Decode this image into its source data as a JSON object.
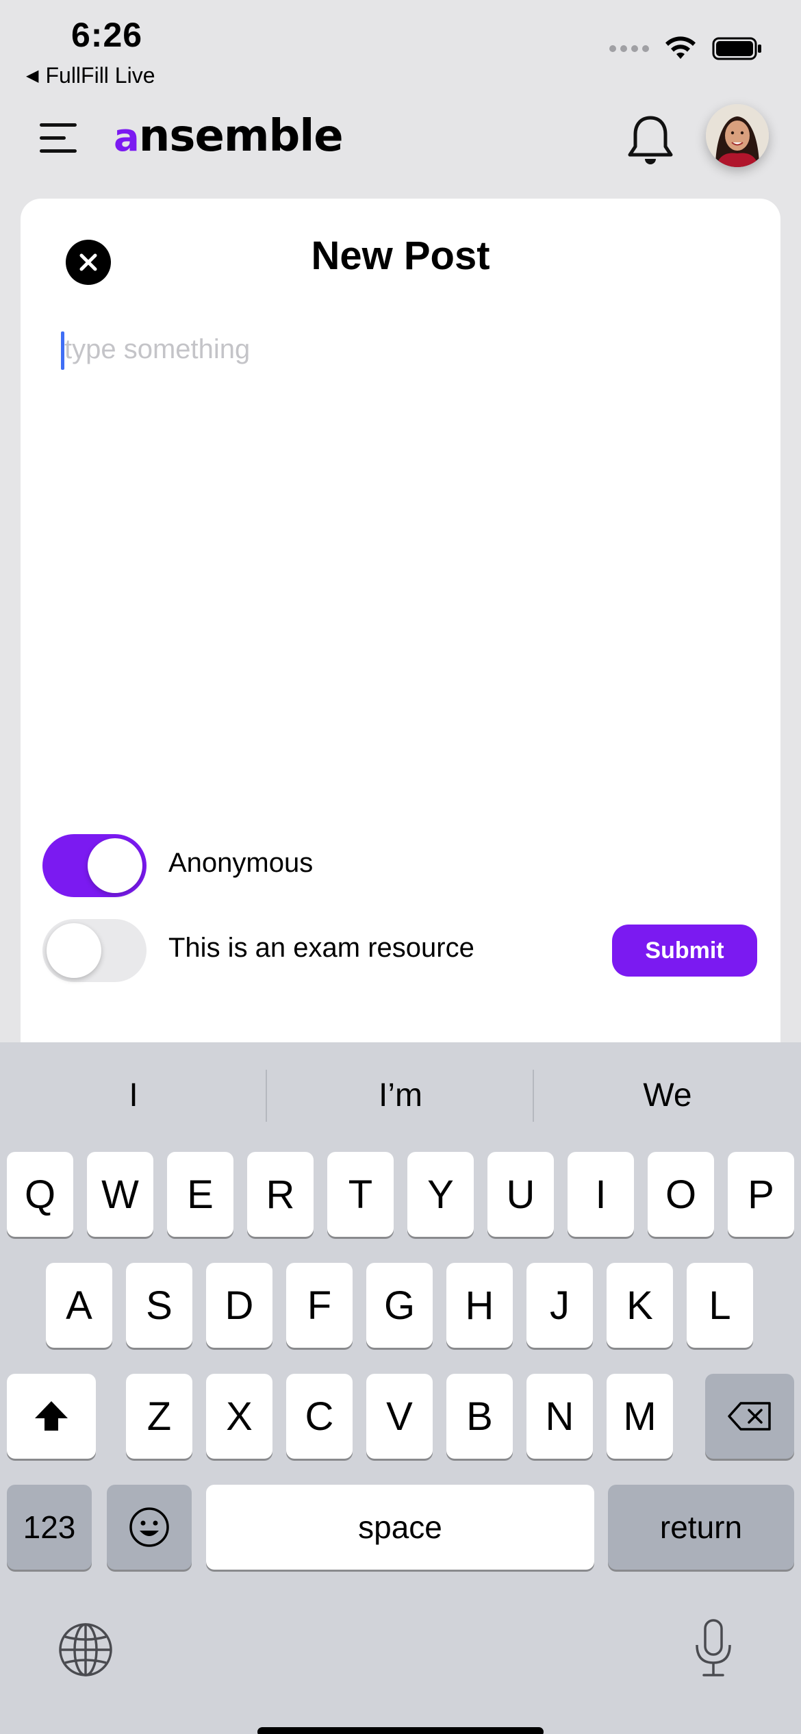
{
  "status_bar": {
    "time": "6:26",
    "back_app": "FullFill Live"
  },
  "header": {
    "logo_accent": "a",
    "logo_rest": "nsemble",
    "brand_color": "#7b1af1"
  },
  "post": {
    "title": "New Post",
    "input_placeholder": "type something",
    "input_value": "",
    "anonymous_label": "Anonymous",
    "anonymous_on": true,
    "exam_label": "This is an exam resource",
    "exam_on": false,
    "submit_label": "Submit"
  },
  "keyboard": {
    "suggestions": [
      "I",
      "I’m",
      "We"
    ],
    "row1": [
      "Q",
      "W",
      "E",
      "R",
      "T",
      "Y",
      "U",
      "I",
      "O",
      "P"
    ],
    "row2": [
      "A",
      "S",
      "D",
      "F",
      "G",
      "H",
      "J",
      "K",
      "L"
    ],
    "row3": [
      "Z",
      "X",
      "C",
      "V",
      "B",
      "N",
      "M"
    ],
    "numbers_label": "123",
    "space_label": "space",
    "return_label": "return"
  }
}
